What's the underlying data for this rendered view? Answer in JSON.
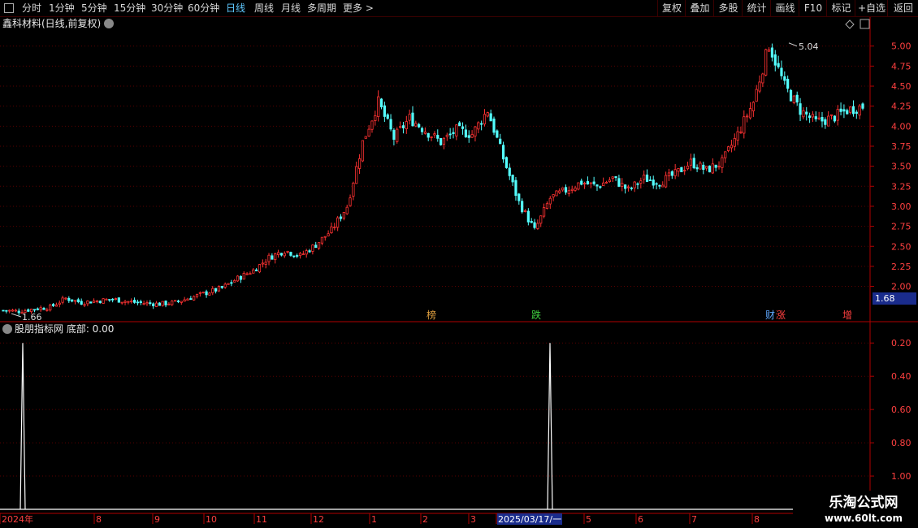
{
  "toolbar": {
    "left_items": [
      "分时",
      "1分钟",
      "5分钟",
      "15分钟",
      "30分钟",
      "60分钟",
      "日线",
      "周线",
      "月线",
      "多周期",
      "更多 >"
    ],
    "active_item": "日线",
    "right_items": [
      "复权",
      "叠加",
      "多股",
      "统计",
      "画线",
      "F10",
      "标记",
      "+自选",
      "返回"
    ]
  },
  "chart_title": "鑫科材料(日线,前复权)",
  "current_price_label": "1.68",
  "high_label": "5.04",
  "low_label": "1.66",
  "event_markers": [
    {
      "label": "榜",
      "color": "#e0a040"
    },
    {
      "label": "跌",
      "color": "#40d040"
    },
    {
      "label": "财",
      "color": "#5fa8ff"
    },
    {
      "label": "涨",
      "color": "#ff4040"
    },
    {
      "label": "增",
      "color": "#ff4040"
    }
  ],
  "price_axis_labels": [
    "5.00",
    "4.75",
    "4.50",
    "4.25",
    "4.00",
    "3.75",
    "3.50",
    "3.25",
    "3.00",
    "2.75",
    "2.50",
    "2.25",
    "2.00"
  ],
  "indicator_title": "股朋指标网 底部: 0.00",
  "indicator_axis_labels": [
    "1.00",
    "0.80",
    "0.60",
    "0.40",
    "0.20"
  ],
  "date_axis_labels": [
    "2024年",
    "8",
    "9",
    "10",
    "11",
    "12",
    "1",
    "2",
    "3",
    "2025/03/17/一",
    "5",
    "6",
    "7",
    "8"
  ],
  "watermark": {
    "line1": "乐淘公式网",
    "line2": "www.60lt.com"
  },
  "colors": {
    "up": "#ff3232",
    "down": "#54ffff",
    "grid": "#5a0000",
    "axis": "#b00000"
  },
  "chart_data": [
    {
      "type": "candlestick",
      "title": "鑫科材料(日线,前复权)",
      "ylim": [
        1.6,
        5.2
      ],
      "y_ticks": [
        2.0,
        2.25,
        2.5,
        2.75,
        3.0,
        3.25,
        3.5,
        3.75,
        4.0,
        4.25,
        4.5,
        4.75,
        5.0
      ],
      "x_labels": [
        "2024年",
        "8",
        "9",
        "10",
        "11",
        "12",
        "1",
        "2",
        "3",
        "2025/03/17/一",
        "5",
        "6",
        "7",
        "8"
      ],
      "max_point": 5.04,
      "min_point": 1.66,
      "close_profile": [
        1.7,
        1.69,
        1.72,
        1.74,
        1.85,
        1.8,
        1.82,
        1.84,
        1.81,
        1.79,
        1.78,
        1.8,
        1.86,
        1.92,
        1.98,
        2.1,
        2.2,
        2.36,
        2.45,
        2.38,
        2.52,
        2.7,
        3.0,
        3.8,
        4.3,
        3.85,
        4.1,
        3.95,
        3.8,
        3.95,
        3.9,
        4.2,
        3.6,
        3.05,
        2.7,
        3.1,
        3.2,
        3.3,
        3.25,
        3.35,
        3.2,
        3.35,
        3.3,
        3.4,
        3.55,
        3.45,
        3.55,
        3.9,
        4.3,
        5.02,
        4.5,
        4.2,
        4.05,
        4.1,
        4.2,
        4.25
      ],
      "profile_step_days": 5
    },
    {
      "type": "line",
      "title": "股朋指标网 底部: 0.00",
      "ylim": [
        0,
        1.05
      ],
      "y_ticks": [
        0.2,
        0.4,
        0.6,
        0.8,
        1.0
      ],
      "spikes": [
        {
          "date_label": "2024年",
          "value": 1.0
        },
        {
          "date_label": "2025/03/17/一",
          "value": 1.0
        }
      ],
      "baseline": 0.0
    }
  ]
}
